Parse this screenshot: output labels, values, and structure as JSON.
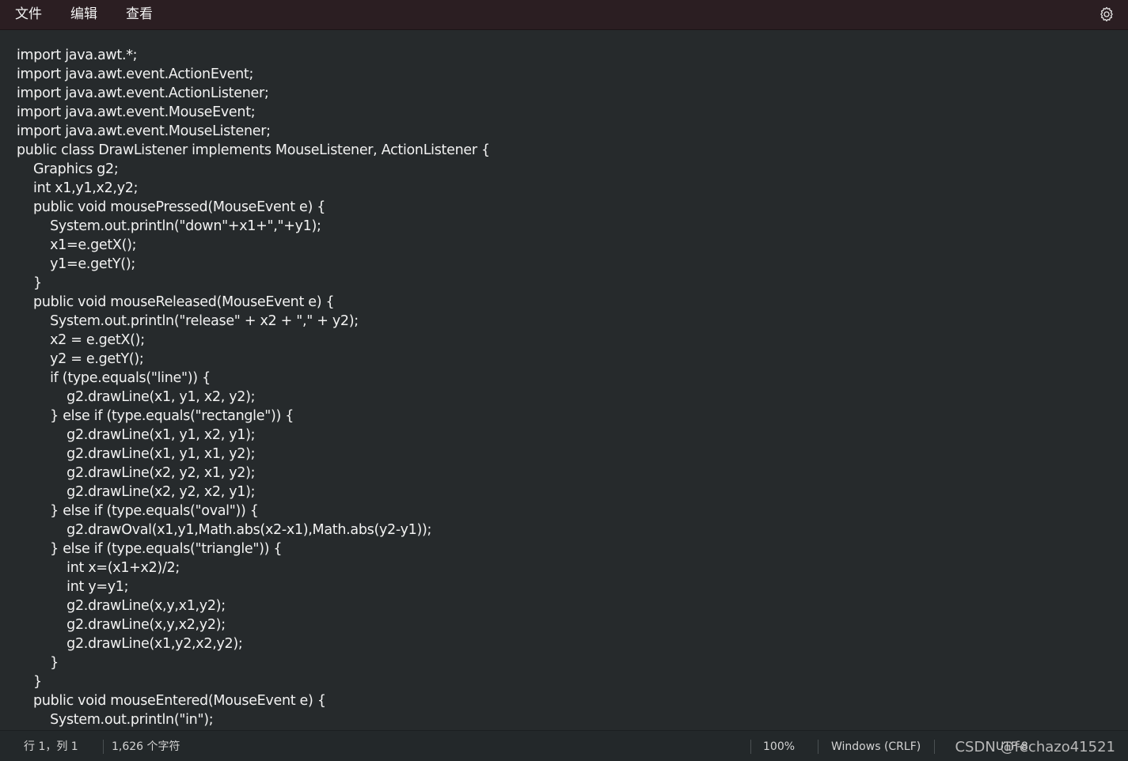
{
  "menubar": {
    "items": [
      "文件",
      "编辑",
      "查看"
    ],
    "settings_icon": "gear-icon"
  },
  "editor": {
    "lines": [
      "import java.awt.*;",
      "import java.awt.event.ActionEvent;",
      "import java.awt.event.ActionListener;",
      "import java.awt.event.MouseEvent;",
      "import java.awt.event.MouseListener;",
      "public class DrawListener implements MouseListener, ActionListener {",
      "    Graphics g2;",
      "    int x1,y1,x2,y2;",
      "    public void mousePressed(MouseEvent e) {",
      "        System.out.println(\"down\"+x1+\",\"+y1);",
      "        x1=e.getX();",
      "        y1=e.getY();",
      "    }",
      "    public void mouseReleased(MouseEvent e) {",
      "        System.out.println(\"release\" + x2 + \",\" + y2);",
      "        x2 = e.getX();",
      "        y2 = e.getY();",
      "        if (type.equals(\"line\")) {",
      "            g2.drawLine(x1, y1, x2, y2);",
      "        } else if (type.equals(\"rectangle\")) {",
      "            g2.drawLine(x1, y1, x2, y1);",
      "            g2.drawLine(x1, y1, x1, y2);",
      "            g2.drawLine(x2, y2, x1, y2);",
      "            g2.drawLine(x2, y2, x2, y1);",
      "        } else if (type.equals(\"oval\")) {",
      "            g2.drawOval(x1,y1,Math.abs(x2-x1),Math.abs(y2-y1));",
      "        } else if (type.equals(\"triangle\")) {",
      "            int x=(x1+x2)/2;",
      "            int y=y1;",
      "            g2.drawLine(x,y,x1,y2);",
      "            g2.drawLine(x,y,x2,y2);",
      "            g2.drawLine(x1,y2,x2,y2);",
      "        }",
      "    }",
      "    public void mouseEntered(MouseEvent e) {",
      "        System.out.println(\"in\");"
    ]
  },
  "statusbar": {
    "position": "行 1，列 1",
    "char_count": "1,626 个字符",
    "zoom": "100%",
    "line_ending": "Windows (CRLF)",
    "encoding": "UTF-8"
  },
  "watermark": "CSDN @fechazo41521",
  "colors": {
    "menubar_bg": "#2b1e22",
    "editor_bg": "#262a2c",
    "statusbar_bg": "#23282a",
    "text": "#f2f2f2"
  }
}
